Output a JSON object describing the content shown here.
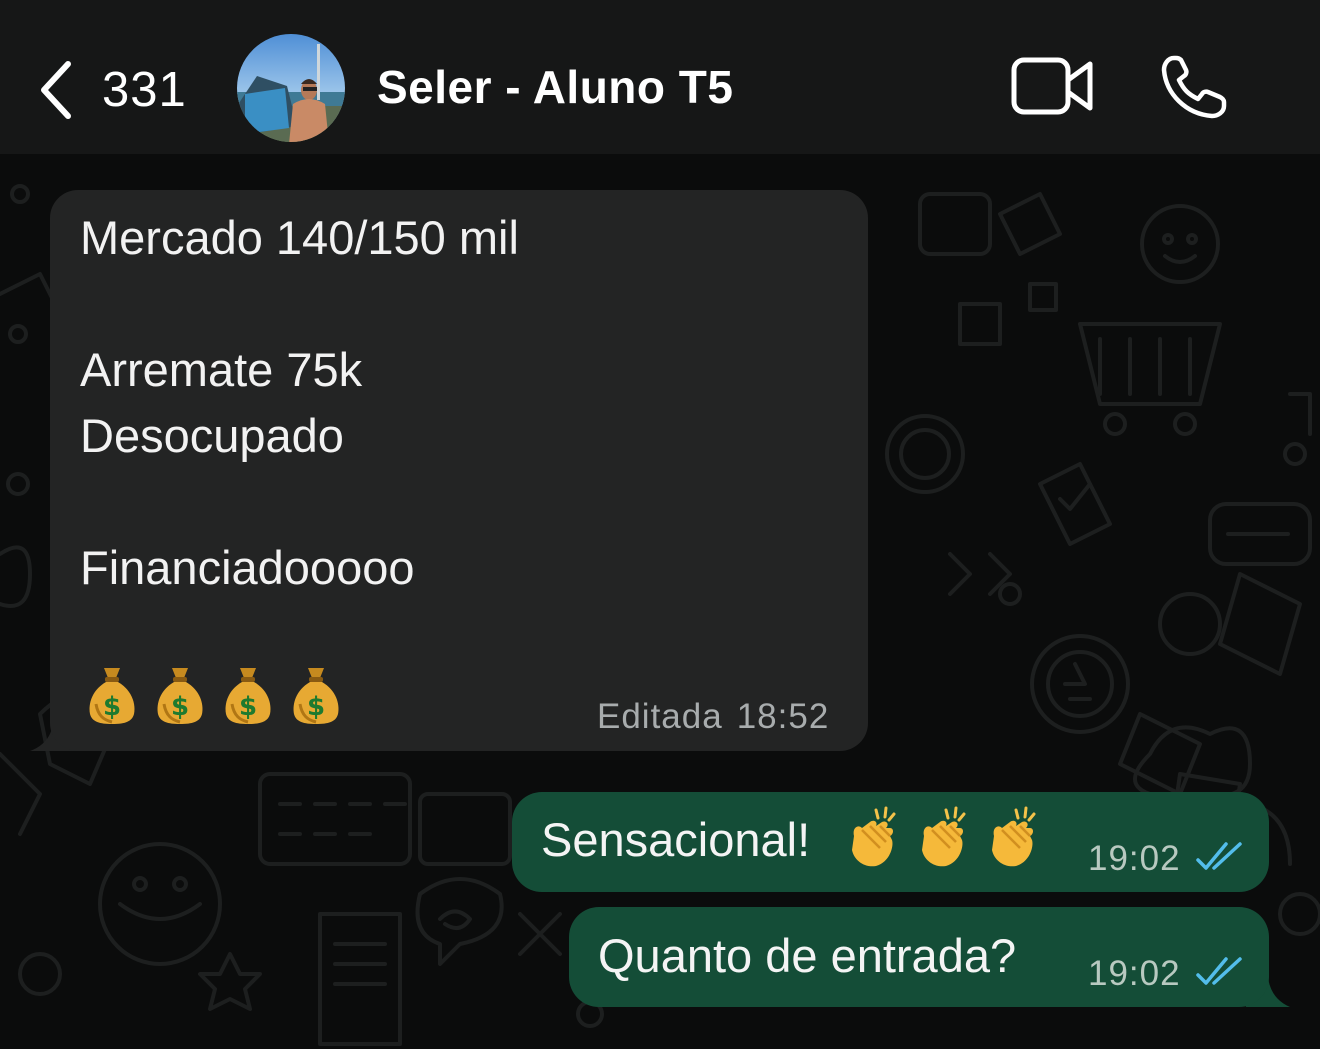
{
  "header": {
    "back_count": "331",
    "contact_name": "Seler - Aluno T5",
    "icons": {
      "back": "chevron-left-icon",
      "video": "video-camera-icon",
      "call": "phone-icon",
      "avatar": "contact-avatar"
    }
  },
  "messages": {
    "incoming": {
      "lines": [
        "Mercado 140/150 mil",
        "Arremate 75k",
        "Desocupado",
        "Financiadooooo"
      ],
      "emoji": [
        "money-bag-icon",
        "money-bag-icon",
        "money-bag-icon",
        "money-bag-icon"
      ],
      "edited_label": "Editada",
      "time": "18:52"
    },
    "outgoing": [
      {
        "text": "Sensacional!",
        "emoji": [
          "clapping-hands-icon",
          "clapping-hands-icon",
          "clapping-hands-icon"
        ],
        "time": "19:02",
        "status": "read"
      },
      {
        "text": "Quanto de entrada?",
        "time": "19:02",
        "status": "read"
      }
    ]
  },
  "colors": {
    "header_bg": "#161717",
    "chat_bg": "#0b0c0c",
    "incoming_bubble": "#232424",
    "outgoing_bubble": "#144d37",
    "read_tick": "#53bdeb"
  }
}
